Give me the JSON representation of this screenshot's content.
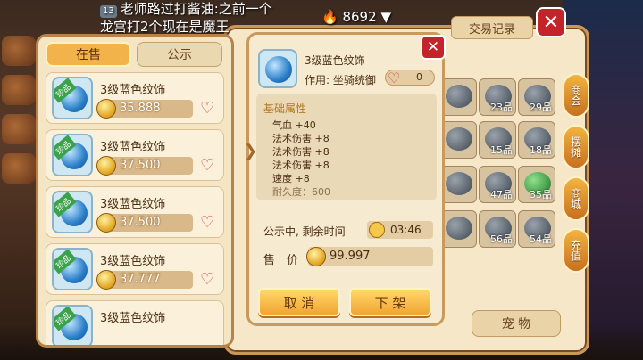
{
  "chat": {
    "level": "13",
    "line1": "老师路过打酱油:之前一个",
    "line2": "龙宫打2个现在是魔王",
    "heat": "8692"
  },
  "tabs": {
    "on_sale": "在售",
    "public": "公示"
  },
  "trade_panel": {
    "tab_right": "交易记录",
    "pet_button": "宠 物",
    "side_buttons": [
      "商会",
      "摆摊",
      "商城",
      "充值"
    ],
    "slot_counts": [
      "23品",
      "29品",
      "13品",
      "15品",
      "18品",
      "47品",
      "35品",
      "56品",
      "54品"
    ]
  },
  "items": [
    {
      "tag": "珍品",
      "name": "3级蓝色纹饰",
      "price": "35.888"
    },
    {
      "tag": "珍品",
      "name": "3级蓝色纹饰",
      "price": "37.500"
    },
    {
      "tag": "珍品",
      "name": "3级蓝色纹饰",
      "price": "37.500"
    },
    {
      "tag": "珍品",
      "name": "3级蓝色纹饰",
      "price": "37.777"
    },
    {
      "tag": "珍品",
      "name": "3级蓝色纹饰",
      "price": ""
    }
  ],
  "detail": {
    "name": "3级蓝色纹饰",
    "use_label": "作用:",
    "use_value": "坐骑统御",
    "fav_count": "0",
    "attr_title": "基础属性",
    "attrs": [
      "气血 +40",
      "法术伤害 +8",
      "法术伤害 +8",
      "法术伤害 +8",
      "速度 +8",
      "耐久度：600"
    ],
    "status": "公示中, 剩余时间",
    "time_left": "03:46",
    "price_label": "售　价",
    "price": "99.997",
    "cancel": "取 消",
    "delist": "下 架"
  },
  "colors": {
    "accent_gold": "#f2b34a",
    "close_red": "#c4232a",
    "tag_green": "#3aa24a"
  }
}
